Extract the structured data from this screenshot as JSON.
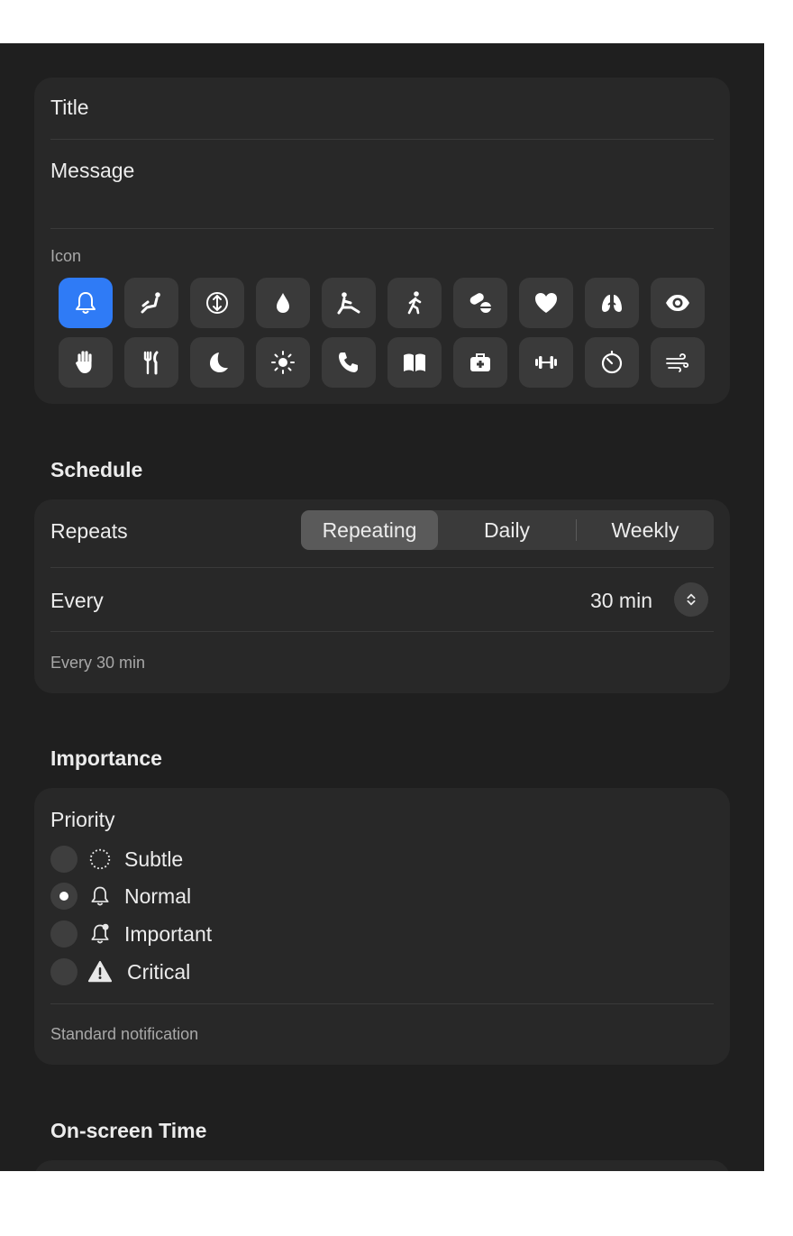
{
  "details": {
    "title_label": "Title",
    "message_label": "Message",
    "icon_label": "Icon",
    "icons": [
      {
        "name": "bell-icon",
        "selected": true
      },
      {
        "name": "recline-icon",
        "selected": false
      },
      {
        "name": "posture-arrows-icon",
        "selected": false
      },
      {
        "name": "water-drop-icon",
        "selected": false
      },
      {
        "name": "stretch-icon",
        "selected": false
      },
      {
        "name": "walking-icon",
        "selected": false
      },
      {
        "name": "pills-icon",
        "selected": false
      },
      {
        "name": "heart-icon",
        "selected": false
      },
      {
        "name": "lungs-icon",
        "selected": false
      },
      {
        "name": "eye-icon",
        "selected": false
      },
      {
        "name": "hand-icon",
        "selected": false
      },
      {
        "name": "fork-knife-icon",
        "selected": false
      },
      {
        "name": "moon-icon",
        "selected": false
      },
      {
        "name": "sun-icon",
        "selected": false
      },
      {
        "name": "phone-icon",
        "selected": false
      },
      {
        "name": "book-icon",
        "selected": false
      },
      {
        "name": "medical-kit-icon",
        "selected": false
      },
      {
        "name": "dumbbell-icon",
        "selected": false
      },
      {
        "name": "timer-icon",
        "selected": false
      },
      {
        "name": "wind-icon",
        "selected": false
      }
    ]
  },
  "schedule": {
    "section_title": "Schedule",
    "repeats_label": "Repeats",
    "segments": [
      "Repeating",
      "Daily",
      "Weekly"
    ],
    "active_segment": "Repeating",
    "every_label": "Every",
    "every_value": "30 min",
    "summary": "Every 30 min"
  },
  "importance": {
    "section_title": "Importance",
    "priority_label": "Priority",
    "options": [
      {
        "label": "Subtle",
        "icon": "dotted-circle-icon",
        "checked": false
      },
      {
        "label": "Normal",
        "icon": "bell-outline-icon",
        "checked": true
      },
      {
        "label": "Important",
        "icon": "bell-badge-icon",
        "checked": false
      },
      {
        "label": "Critical",
        "icon": "warning-triangle-icon",
        "checked": false
      }
    ],
    "description": "Standard notification"
  },
  "onscreen": {
    "section_title": "On-screen Time"
  },
  "colors": {
    "accent": "#2f7bf6",
    "window_bg": "#1f1f1f",
    "card_bg": "#282828"
  }
}
